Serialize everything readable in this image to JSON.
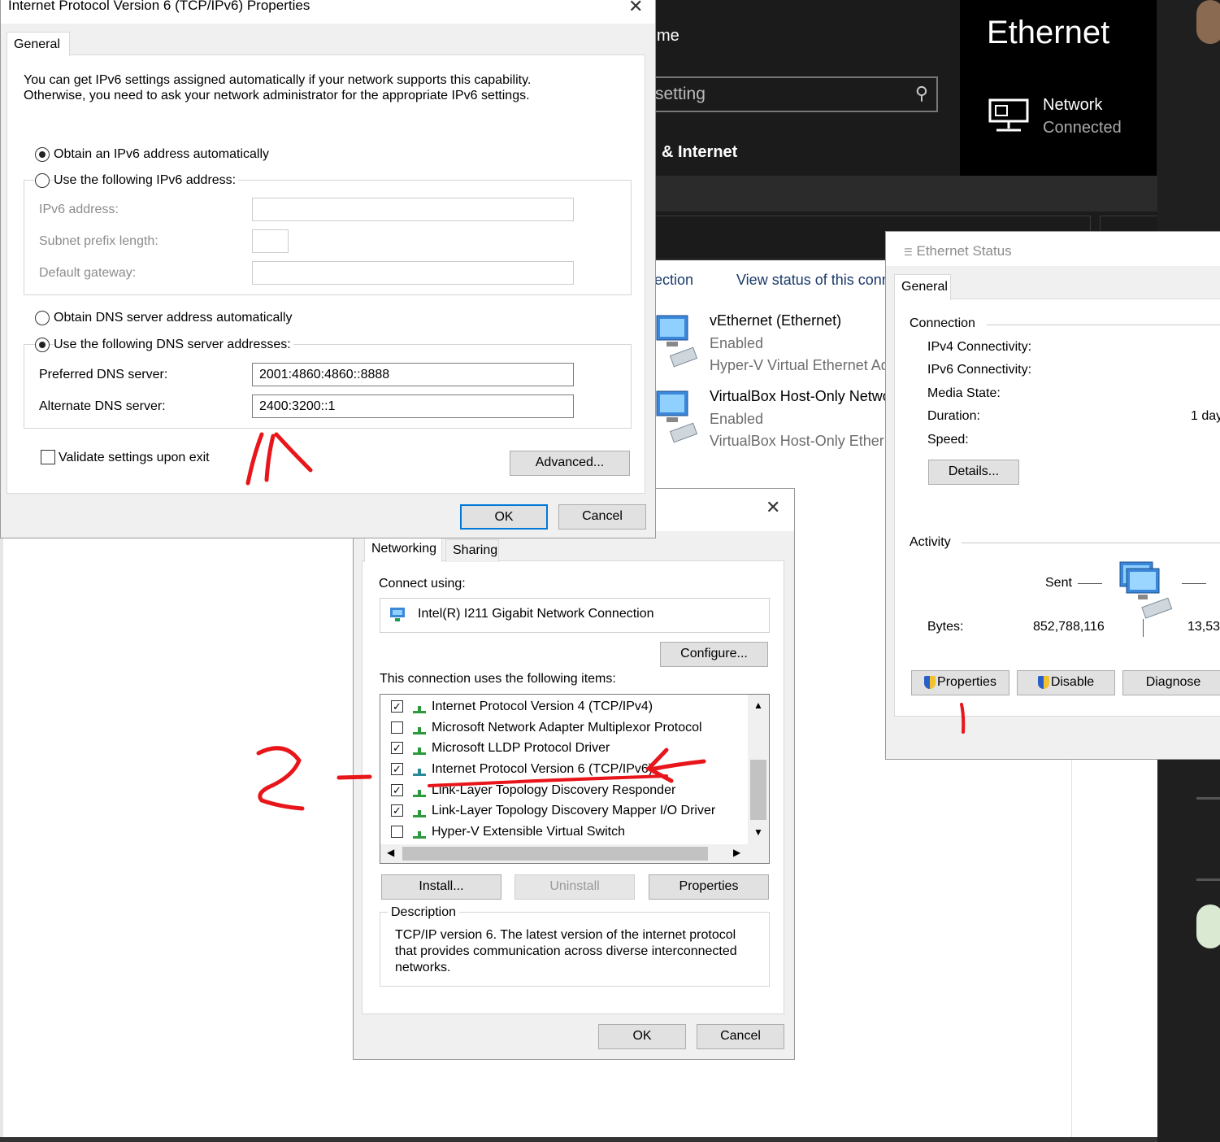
{
  "settings": {
    "home_fragment": "me",
    "search_placeholder": "setting",
    "section_fragment": "& Internet",
    "ethernet_title": "Ethernet",
    "network_label": "Network",
    "network_status": "Connected"
  },
  "network_connections": {
    "toolbar_left": "ection",
    "toolbar_right": "View status of this conn",
    "adapters": [
      {
        "name": "vEthernet (Ethernet)",
        "status": "Enabled",
        "device": "Hyper-V Virtual Ethernet Ad"
      },
      {
        "name": "VirtualBox Host-Only Netwo",
        "status": "Enabled",
        "device": "VirtualBox Host-Only Etherr"
      }
    ]
  },
  "ipv6_dialog": {
    "title": "Internet Protocol Version 6 (TCP/IPv6) Properties",
    "tab": "General",
    "intro_line1": "You can get IPv6 settings assigned automatically if your network supports this capability.",
    "intro_line2": "Otherwise, you need to ask your network administrator for the appropriate IPv6 settings.",
    "radio_auto_ip": "Obtain an IPv6 address automatically",
    "radio_manual_ip": "Use the following IPv6 address:",
    "ipv6_address_label": "IPv6 address:",
    "subnet_label": "Subnet prefix length:",
    "gateway_label": "Default gateway:",
    "radio_auto_dns": "Obtain DNS server address automatically",
    "radio_manual_dns": "Use the following DNS server addresses:",
    "preferred_dns_label": "Preferred DNS server:",
    "preferred_dns_value": "2001:4860:4860::8888",
    "alternate_dns_label": "Alternate DNS server:",
    "alternate_dns_value": "2400:3200::1",
    "validate_label": "Validate settings upon exit",
    "advanced_button": "Advanced...",
    "ok_button": "OK",
    "cancel_button": "Cancel",
    "selected_ip_mode": "auto",
    "selected_dns_mode": "manual",
    "validate_checked": false
  },
  "adapter_properties": {
    "tab_networking": "Networking",
    "tab_sharing": "Sharing",
    "connect_using_label": "Connect using:",
    "adapter_name": "Intel(R) I211 Gigabit Network Connection",
    "configure_button": "Configure...",
    "items_label": "This connection uses the following items:",
    "items": [
      {
        "label": "Internet Protocol Version 4 (TCP/IPv4)",
        "checked": true
      },
      {
        "label": "Microsoft Network Adapter Multiplexor Protocol",
        "checked": false
      },
      {
        "label": "Microsoft LLDP Protocol Driver",
        "checked": true
      },
      {
        "label": "Internet Protocol Version 6 (TCP/IPv6)",
        "checked": true
      },
      {
        "label": "Link-Layer Topology Discovery Responder",
        "checked": true
      },
      {
        "label": "Link-Layer Topology Discovery Mapper I/O Driver",
        "checked": true
      },
      {
        "label": "Hyper-V Extensible Virtual Switch",
        "checked": false
      }
    ],
    "install_button": "Install...",
    "uninstall_button": "Uninstall",
    "properties_button": "Properties",
    "description_label": "Description",
    "description_text_1": "TCP/IP version 6. The latest version of the internet protocol",
    "description_text_2": "that provides communication across diverse interconnected",
    "description_text_3": "networks.",
    "ok_button": "OK",
    "cancel_button": "Cancel"
  },
  "ethernet_status": {
    "title": "Ethernet Status",
    "tab": "General",
    "connection_label": "Connection",
    "ipv4_label": "IPv4 Connectivity:",
    "ipv6_label": "IPv6 Connectivity:",
    "media_label": "Media State:",
    "duration_label": "Duration:",
    "duration_value": "1 day",
    "speed_label": "Speed:",
    "details_button": "Details...",
    "activity_label": "Activity",
    "sent_label": "Sent",
    "bytes_label": "Bytes:",
    "bytes_sent": "852,788,116",
    "bytes_received": "13,53",
    "properties_button": "Properties",
    "disable_button": "Disable",
    "diagnose_button": "Diagnose"
  },
  "annotations": {
    "mark_1": "1",
    "mark_2": "2",
    "mark_3": "1^",
    "color": "#e8161b"
  }
}
